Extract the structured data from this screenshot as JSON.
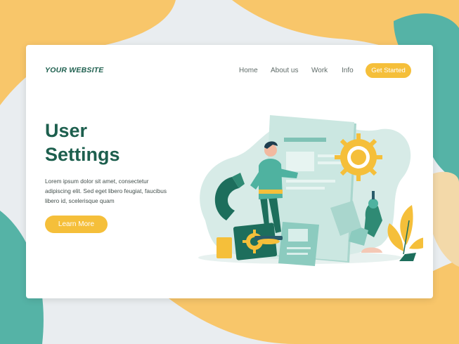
{
  "header": {
    "logo_prefix": "YOUR",
    "logo_main": "WEBSITE",
    "nav": [
      "Home",
      "About us",
      "Work",
      "Info"
    ],
    "cta_label": "Get Started"
  },
  "hero": {
    "title_line1": "User",
    "title_line2": "Settings",
    "body": "Lorem ipsum dolor sit amet, consectetur adipiscing elit. Sed eget libero feugiat, faucibus libero id, scelerisque quam",
    "button_label": "Learn More"
  },
  "colors": {
    "primary_dark": "#1d5f4e",
    "accent_yellow": "#f5bf3a",
    "teal": "#4fb2a0",
    "mint_light": "#cfe6e2",
    "background": "#e8ecef"
  },
  "illustration": {
    "icons": [
      "gear-icon",
      "robot-arm-icon",
      "magnet-icon",
      "document-icon",
      "plant-icon"
    ]
  }
}
